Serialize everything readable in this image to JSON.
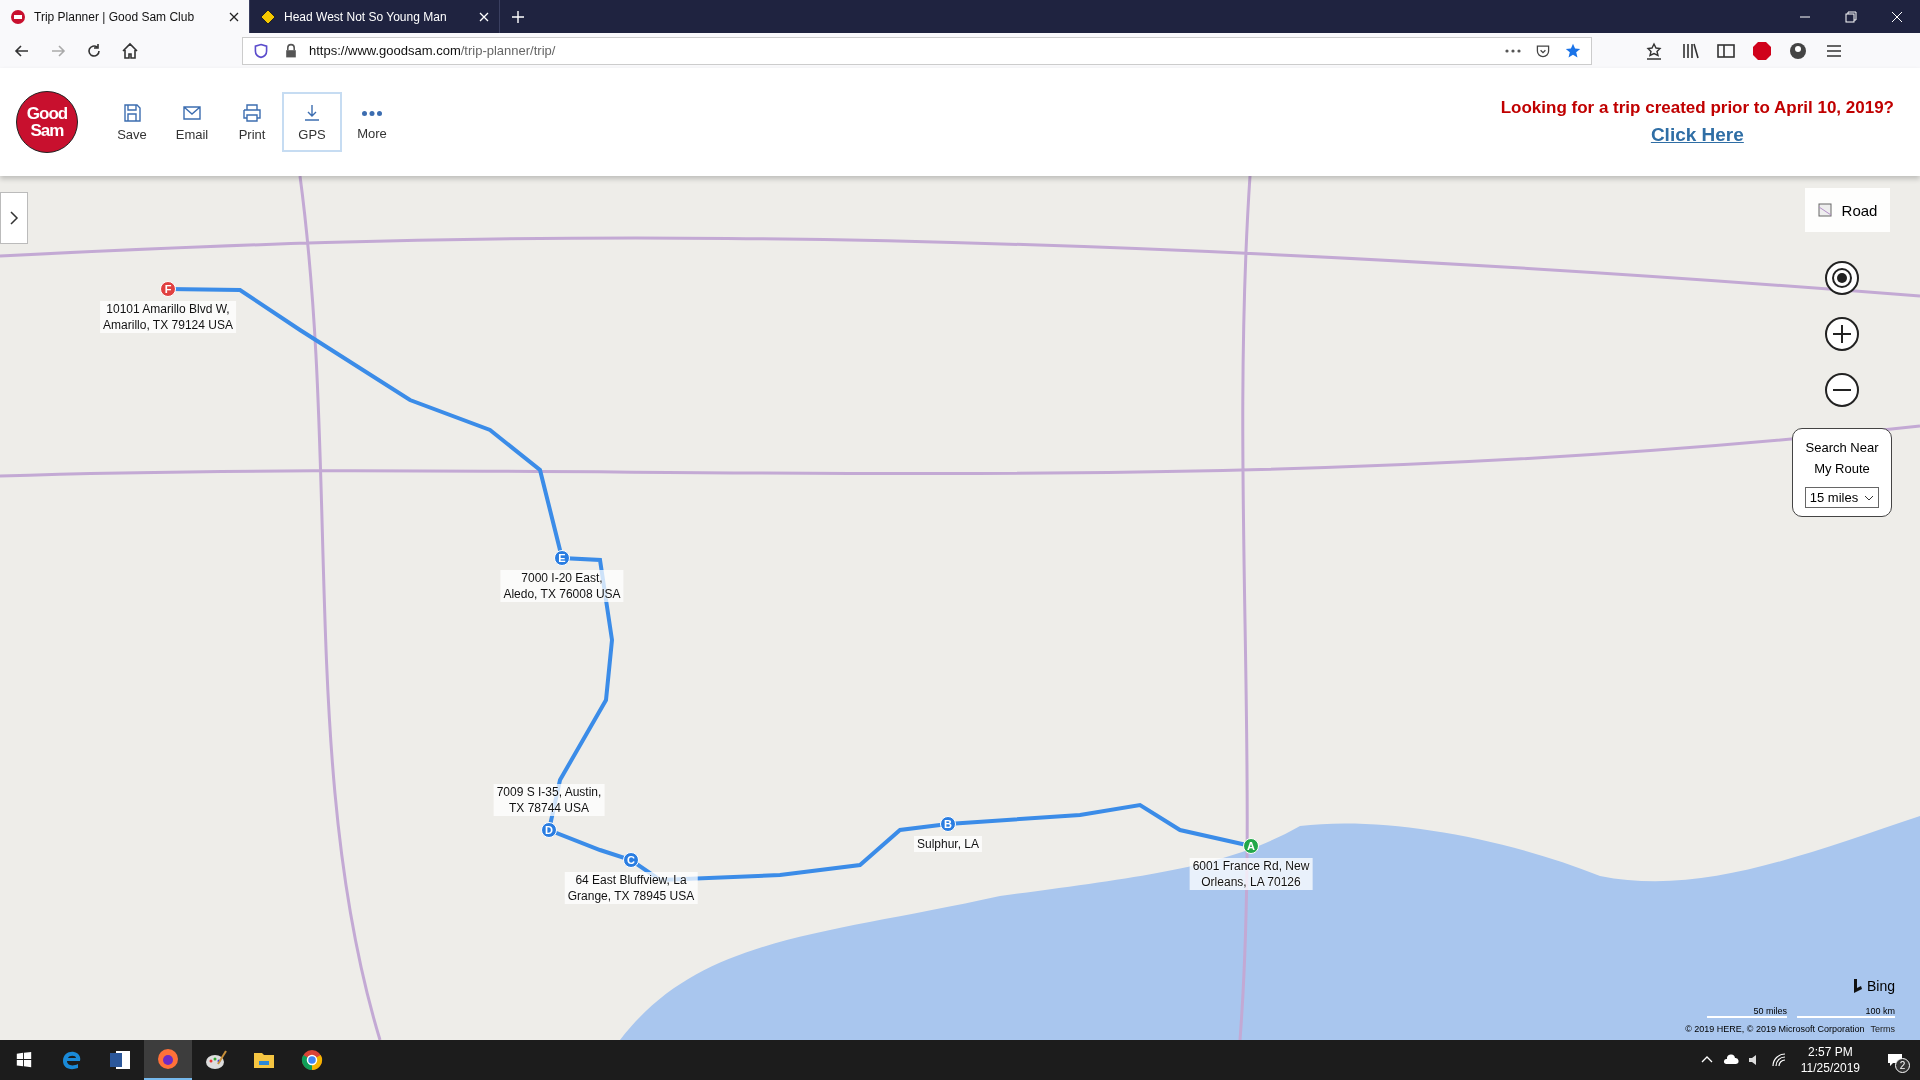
{
  "browser": {
    "tabs": [
      {
        "title": "Trip Planner | Good Sam Club",
        "selected": true,
        "kind": "goodsam"
      },
      {
        "title": "Head West Not So Young Man",
        "selected": false,
        "kind": "sign"
      }
    ],
    "url_host": "https://www.goodsam.com",
    "url_path": "/trip-planner/trip/"
  },
  "header": {
    "logo_lines": [
      "Good",
      "Sam"
    ],
    "toolbar": [
      {
        "label": "Save",
        "kind": "save",
        "selected": false
      },
      {
        "label": "Email",
        "kind": "email",
        "selected": false
      },
      {
        "label": "Print",
        "kind": "print",
        "selected": false
      },
      {
        "label": "GPS",
        "kind": "gps",
        "selected": true
      },
      {
        "label": "More",
        "kind": "more",
        "selected": false
      }
    ],
    "notice": "Looking for a trip created prior to April 10, 2019?",
    "notice_link": "Click Here"
  },
  "map": {
    "style_label": "Road",
    "search_near": "Search Near My Route",
    "radius": "15 miles",
    "waypoints": [
      {
        "letter": "F",
        "color": "#e04040",
        "address": [
          "10101 Amarillo Blvd W,",
          "Amarillo, TX 79124 USA"
        ]
      },
      {
        "letter": "E",
        "color": "#2a7de1",
        "address": [
          "7000 I-20 East,",
          "Aledo, TX 76008 USA"
        ]
      },
      {
        "letter": "D",
        "color": "#2a7de1",
        "address": [
          "7009 S I-35, Austin,",
          "TX 78744 USA"
        ]
      },
      {
        "letter": "C",
        "color": "#2a7de1",
        "address": [
          "64 East Bluffview, La",
          "Grange, TX 78945 USA"
        ]
      },
      {
        "letter": "B",
        "color": "#2a7de1",
        "address": [
          "Sulphur, LA"
        ]
      },
      {
        "letter": "A",
        "color": "#22a84a",
        "address": [
          "6001 France Rd, New",
          "Orleans, LA 70126"
        ]
      }
    ],
    "attribution": "Bing",
    "scale_miles": "50 miles",
    "scale_km": "100 km",
    "copyright": "© 2019 HERE, © 2019 Microsoft Corporation",
    "terms": "Terms"
  },
  "taskbar": {
    "apps": [
      {
        "kind": "edge",
        "selected": false
      },
      {
        "kind": "word",
        "selected": false
      },
      {
        "kind": "firefox",
        "selected": true
      },
      {
        "kind": "paint",
        "selected": false
      },
      {
        "kind": "folder",
        "selected": false
      },
      {
        "kind": "chrome",
        "selected": false
      }
    ],
    "time": "2:57 PM",
    "date": "11/25/2019",
    "notifications": "2"
  }
}
